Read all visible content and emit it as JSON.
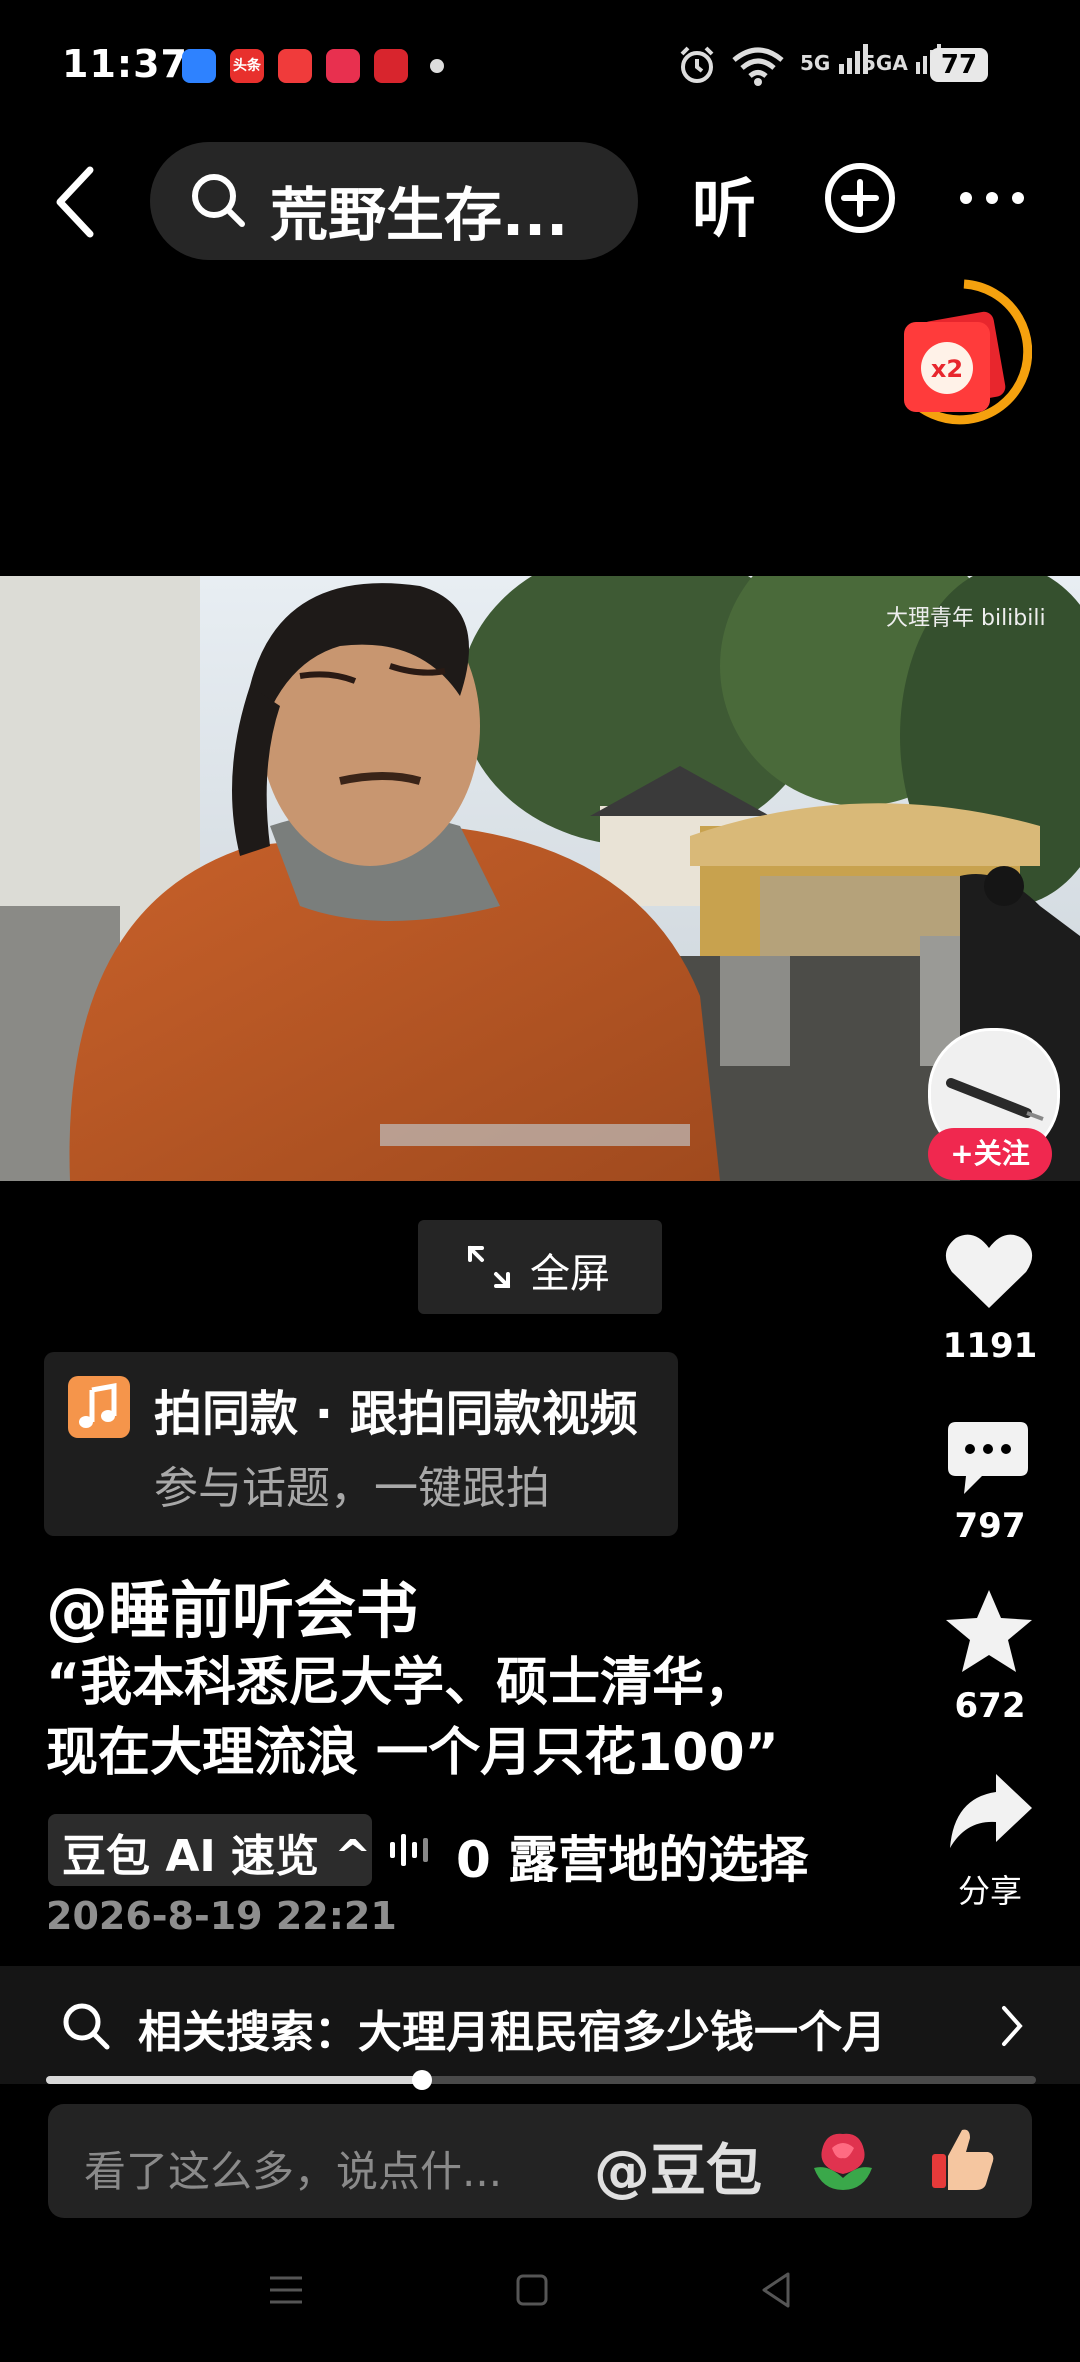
{
  "status_bar": {
    "time": "11:37",
    "app_icons": [
      {
        "name": "browser-app-icon",
        "color": "#2e82ff",
        "text": ""
      },
      {
        "name": "toutiao-app-icon",
        "color": "#e8302d",
        "text": "头条"
      },
      {
        "name": "video-app-icon",
        "color": "#f03b3b",
        "text": ""
      },
      {
        "name": "pet-app-icon",
        "color": "#e8304f",
        "text": ""
      },
      {
        "name": "bank-app-icon",
        "color": "#d8252d",
        "text": ""
      }
    ],
    "signal_1": "5G",
    "signal_2": "5GA",
    "battery": "77"
  },
  "header": {
    "search_text": "荒野生存...",
    "listen_label": "听"
  },
  "red_packet": {
    "multiplier": "x2"
  },
  "video": {
    "watermark": "大理青年 bilibili",
    "follow_label": "+关注"
  },
  "fullscreen": {
    "label": "全屏"
  },
  "actions": {
    "likes": "1191",
    "comments": "797",
    "favorites": "672",
    "share": "分享"
  },
  "music_card": {
    "title": "拍同款 · 跟拍同款视频",
    "subtitle": "参与话题，一键跟拍"
  },
  "post": {
    "author": "@睡前听会书",
    "desc_line1": "“我本科悉尼大学、硕士清华，",
    "desc_line2": "现在大理流浪 一个月只花100”",
    "ai_label": "豆包 AI 速览 ^",
    "ai_marquee": "0 露营地的选择",
    "date": "2026-8-19 22:21"
  },
  "related_search": {
    "label": "相关搜索：大理月租民宿多少钱一个月"
  },
  "progress": {
    "fraction": 0.38
  },
  "comment_bar": {
    "placeholder": "看了这么多，说点什...",
    "mention": "@豆包"
  }
}
